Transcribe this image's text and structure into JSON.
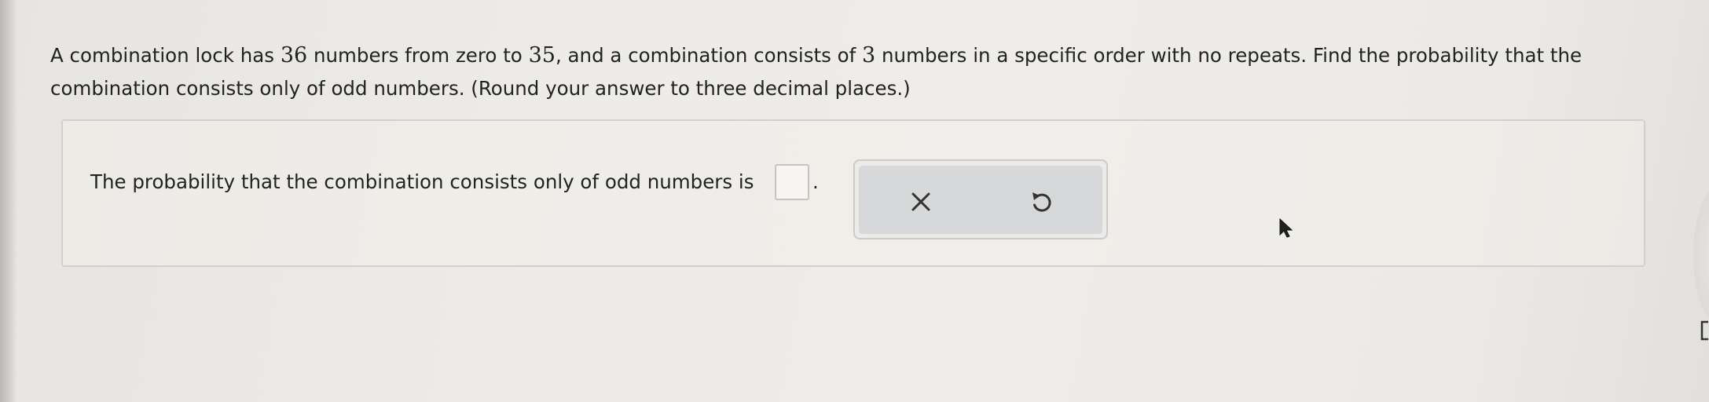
{
  "question": {
    "text_part1": "A combination lock has ",
    "num_total": "36",
    "text_part2": " numbers from zero to ",
    "num_max": "35",
    "text_part3": ", and a combination consists of ",
    "num_count": "3",
    "text_part4": " numbers in a specific order with no repeats. Find the probability that the combination consists only of odd numbers. (Round your answer to three decimal places.)"
  },
  "answer": {
    "sentence": "The probability that the combination consists only of odd numbers is",
    "input_value": "",
    "period": "."
  },
  "actions": {
    "clear_icon": "x-icon",
    "undo_icon": "undo-icon"
  },
  "colors": {
    "background": "#eeece8",
    "panel_border": "#d2d0cc",
    "tray_fill": "#d7d8d9",
    "icon": "#333333"
  }
}
